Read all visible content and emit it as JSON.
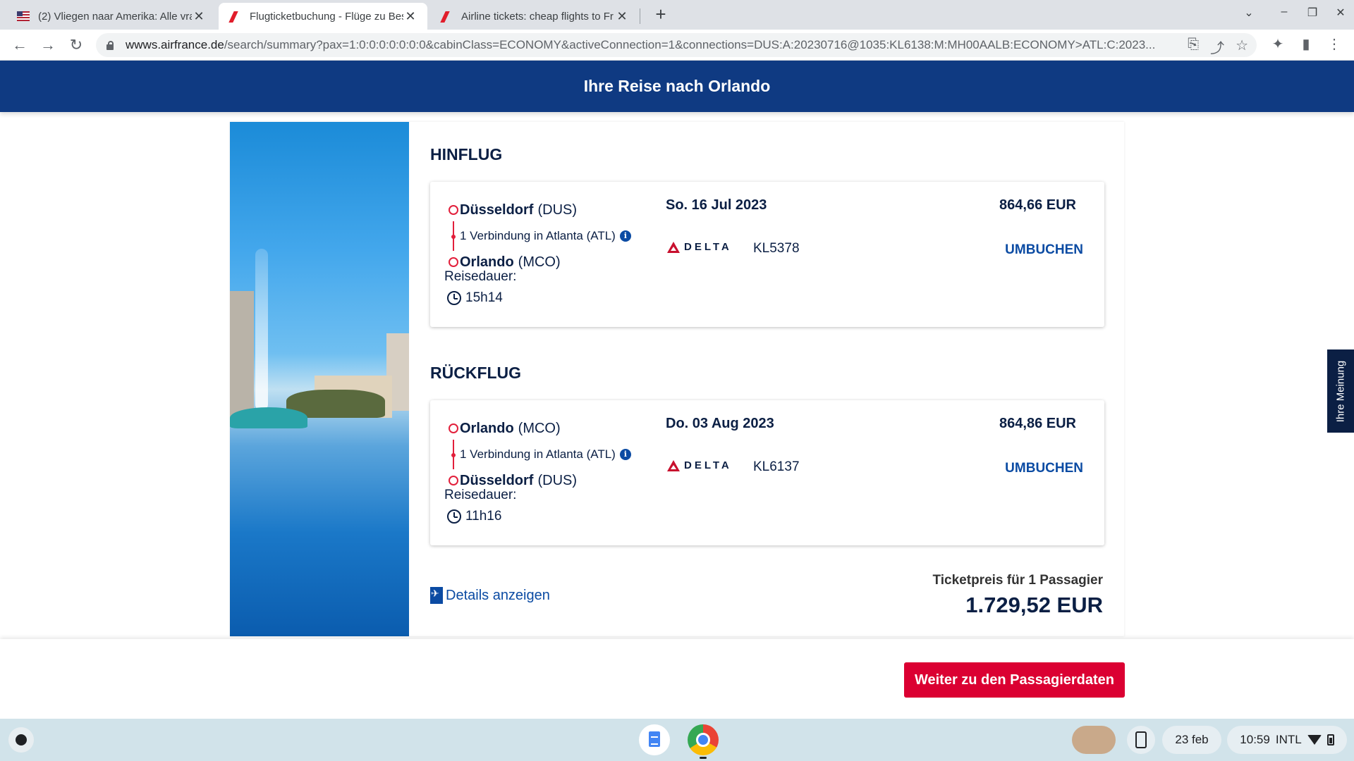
{
  "browser": {
    "tabs": [
      {
        "title": "(2) Vliegen naar Amerika: Alle vra",
        "favicon": "us-flag-icon"
      },
      {
        "title": "Flugticketbuchung - Flüge zu Bes",
        "favicon": "airfrance-icon"
      },
      {
        "title": "Airline tickets: cheap flights to Fr",
        "favicon": "airfrance-icon"
      }
    ],
    "url_host": "wwws.airfrance.de",
    "url_path": "/search/summary?pax=1:0:0:0:0:0:0:0&cabinClass=ECONOMY&activeConnection=1&connections=DUS:A:20230716@1035:KL6138:M:MH00AALB:ECONOMY>ATL:C:2023..."
  },
  "header": {
    "title": "Ihre Reise nach Orlando"
  },
  "outbound": {
    "section_title": "HINFLUG",
    "from_city": "Düsseldorf",
    "from_code": "(DUS)",
    "connection": "1 Verbindung in Atlanta (ATL)",
    "to_city": "Orlando",
    "to_code": "(MCO)",
    "duration_label": "Reisedauer:",
    "duration": "15h14",
    "date": "So. 16 Jul 2023",
    "airline": "DELTA",
    "flight_number": "KL5378",
    "price": "864,66 EUR",
    "rebook_label": "UMBUCHEN"
  },
  "return": {
    "section_title": "RÜCKFLUG",
    "from_city": "Orlando",
    "from_code": "(MCO)",
    "connection": "1 Verbindung in Atlanta (ATL)",
    "to_city": "Düsseldorf",
    "to_code": "(DUS)",
    "duration_label": "Reisedauer:",
    "duration": "11h16",
    "date": "Do. 03 Aug 2023",
    "airline": "DELTA",
    "flight_number": "KL6137",
    "price": "864,86 EUR",
    "rebook_label": "UMBUCHEN"
  },
  "summary": {
    "details_label": "Details anzeigen",
    "ticket_label": "Ticketpreis für 1 Passagier",
    "total": "1.729,52 EUR"
  },
  "actions": {
    "continue_label": "Weiter zu den Passagierdaten"
  },
  "feedback": {
    "label": "Ihre Meinung"
  },
  "shelf": {
    "date": "23 feb",
    "time": "10:59",
    "input_method": "INTL"
  },
  "colors": {
    "brand_blue": "#0f3a82",
    "accent_red": "#db0032",
    "link_blue": "#0b4ba3"
  }
}
